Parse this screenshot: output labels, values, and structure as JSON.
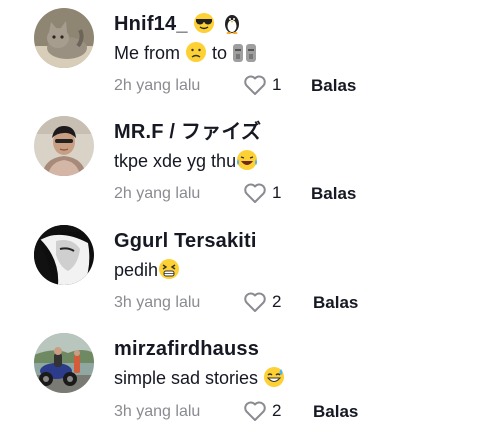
{
  "comments": [
    {
      "username": "Hnif14_",
      "username_emojis": [
        "sunglasses-face-emoji",
        "penguin-emoji"
      ],
      "text_part1": "Me from",
      "text_emoji1": "sad-face-emoji",
      "text_part2": "to",
      "text_emoji2": "moai-emoji",
      "time": "2h yang lalu",
      "likes": "1",
      "reply_label": "Balas"
    },
    {
      "username": "MR.F / ファイズ",
      "text": "tkpe xde yg thu",
      "text_emoji": "laughing-tears-emoji",
      "time": "2h yang lalu",
      "likes": "1",
      "reply_label": "Balas"
    },
    {
      "username": "Ggurl Tersakiti",
      "text": "pedih",
      "text_emoji": "tired-face-emoji",
      "time": "3h yang lalu",
      "likes": "2",
      "reply_label": "Balas"
    },
    {
      "username": "mirzafirdhauss",
      "text": "simple sad stories",
      "text_emoji": "grinning-sweat-emoji",
      "time": "3h yang lalu",
      "likes": "2",
      "reply_label": "Balas"
    }
  ]
}
